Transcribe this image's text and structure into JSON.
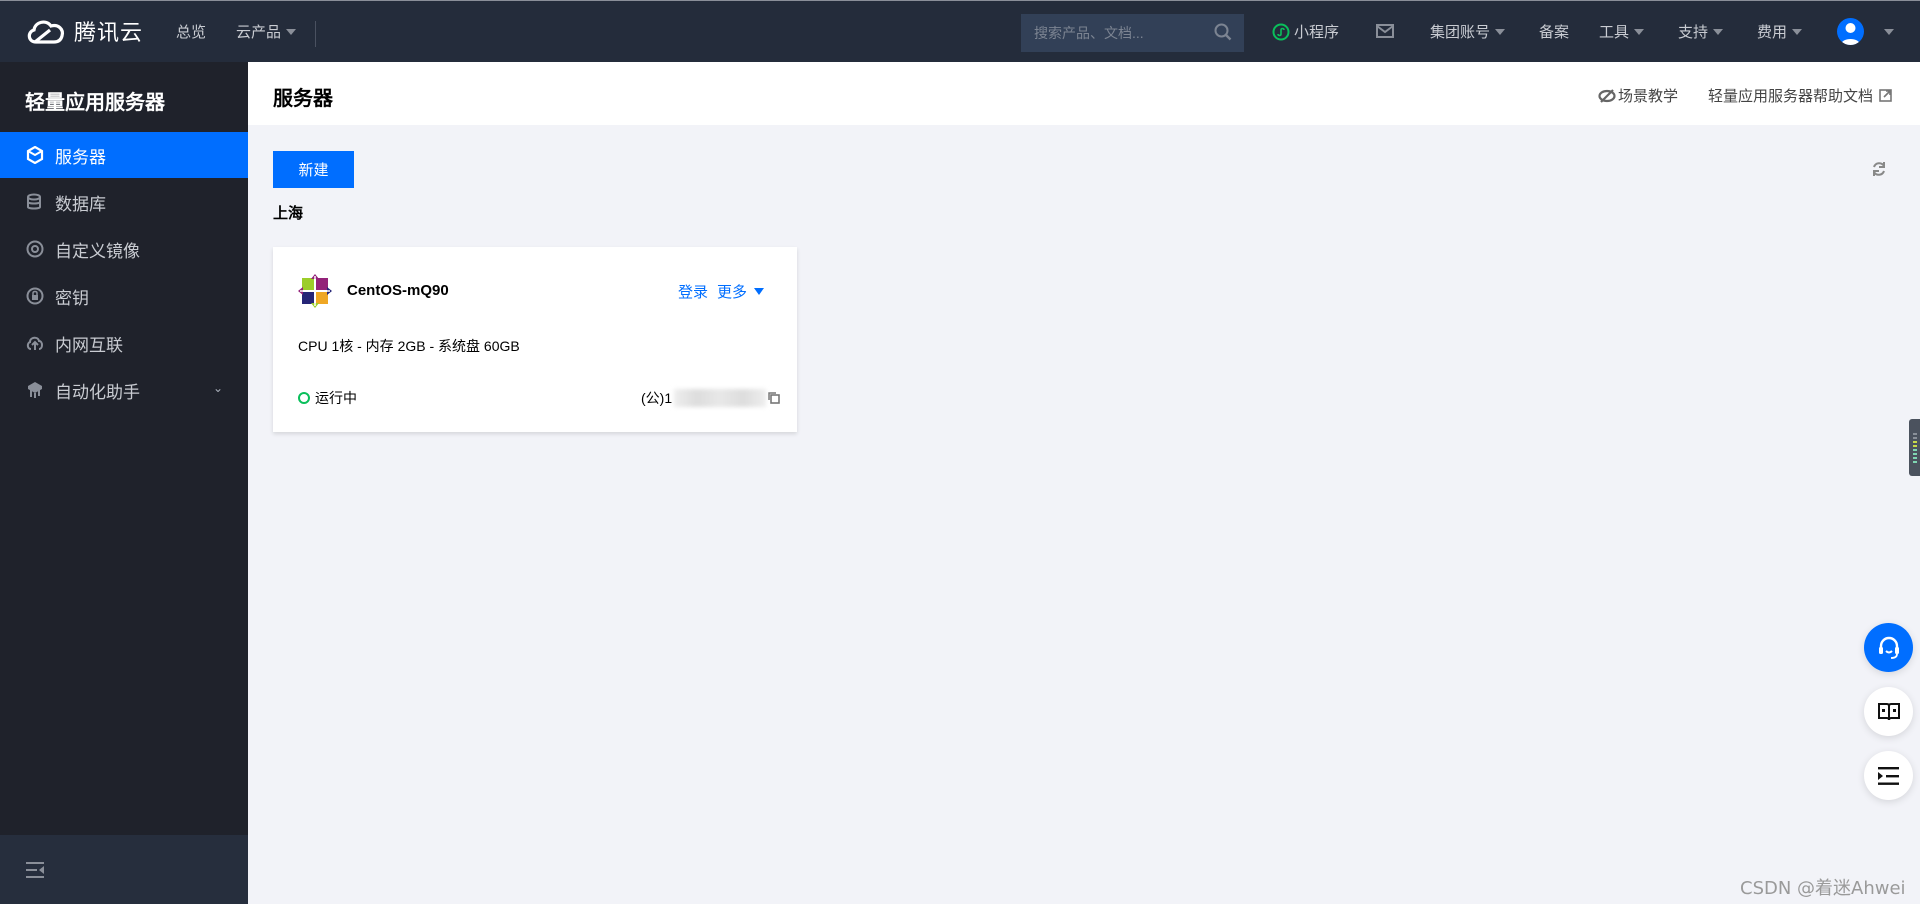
{
  "topnav": {
    "logo_text": "腾讯云",
    "items": [
      {
        "label": "总览"
      },
      {
        "label": "云产品",
        "has_caret": true
      }
    ],
    "search_placeholder": "搜索产品、文档...",
    "right_items": [
      {
        "label": "小程序",
        "icon": "miniprogram-icon"
      },
      {
        "label": "",
        "icon": "mail-icon"
      },
      {
        "label": "集团账号",
        "has_caret": true
      },
      {
        "label": "备案"
      },
      {
        "label": "工具",
        "has_caret": true
      },
      {
        "label": "支持",
        "has_caret": true
      },
      {
        "label": "费用",
        "has_caret": true
      }
    ]
  },
  "sidebar": {
    "title": "轻量应用服务器",
    "items": [
      {
        "label": "服务器",
        "icon": "server-icon",
        "active": true
      },
      {
        "label": "数据库",
        "icon": "database-icon"
      },
      {
        "label": "自定义镜像",
        "icon": "image-icon"
      },
      {
        "label": "密钥",
        "icon": "key-icon"
      },
      {
        "label": "内网互联",
        "icon": "network-icon"
      },
      {
        "label": "自动化助手",
        "icon": "automation-icon",
        "expandable": true
      }
    ]
  },
  "header": {
    "title": "服务器",
    "links": [
      {
        "label": "场景教学",
        "icon": "scene-icon"
      },
      {
        "label": "轻量应用服务器帮助文档",
        "icon": "external-link-icon"
      }
    ]
  },
  "content": {
    "new_button": "新建",
    "region": "上海",
    "instances": [
      {
        "name": "CentOS-mQ90",
        "os": "CentOS",
        "actions": [
          "登录",
          "更多"
        ],
        "spec": "CPU 1核 - 内存 2GB - 系统盘 60GB",
        "status": "运行中",
        "status_color": "#0abf5b",
        "ip_prefix": "(公)1"
      }
    ]
  },
  "colors": {
    "accent": "#006eff",
    "topnav_bg": "#242c3b",
    "sidebar_bg": "#1f222b",
    "content_bg": "#f2f3f8"
  },
  "watermark": "CSDN @着迷Ahwei"
}
